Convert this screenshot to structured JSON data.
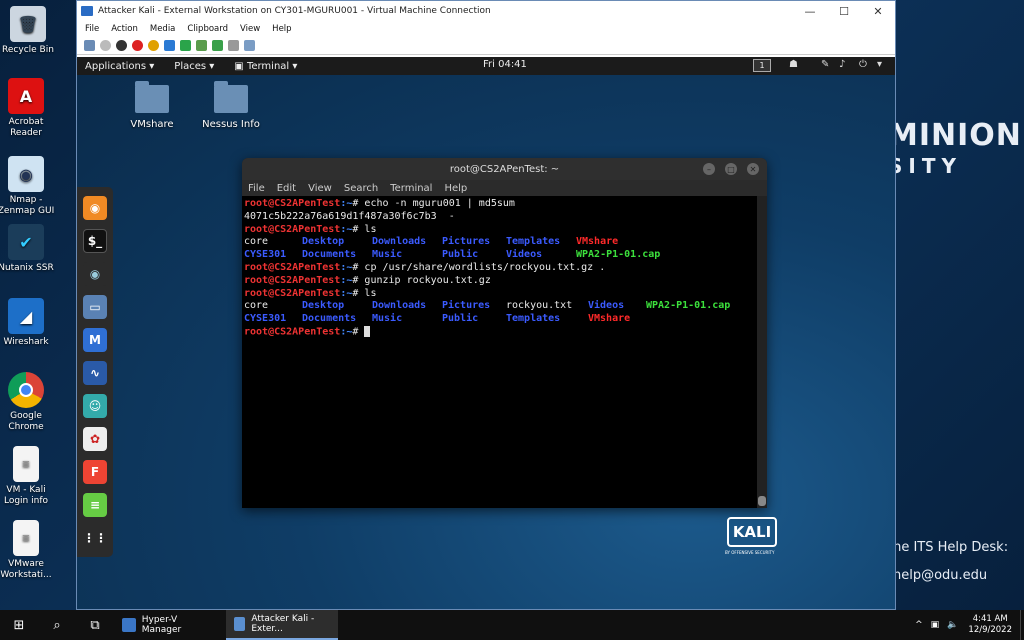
{
  "windows_desktop": {
    "icons": [
      {
        "label": "Recycle Bin"
      },
      {
        "label": "Acrobat Reader"
      },
      {
        "label": "Nmap - Zenmap GUI"
      },
      {
        "label": "Nutanix SSR"
      },
      {
        "label": "Wireshark"
      },
      {
        "label": "Google Chrome"
      },
      {
        "label": "VM - Kali Login info"
      },
      {
        "label": "VMware Workstati..."
      }
    ],
    "bg_text_1": "MINION",
    "bg_text_2": "SITY",
    "help_1": "the ITS Help Desk:",
    "help_2": "help@odu.edu"
  },
  "vm_window": {
    "title": "Attacker Kali - External Workstation on CY301-MGURU001 - Virtual Machine Connection",
    "menu": [
      "File",
      "Action",
      "Media",
      "Clipboard",
      "View",
      "Help"
    ],
    "controls": {
      "minimize": "—",
      "maximize": "☐",
      "close": "✕"
    }
  },
  "kali": {
    "topbar": {
      "applications": "Applications ▾",
      "places": "Places ▾",
      "terminal": "Terminal ▾",
      "clock": "Fri 04:41",
      "workspace": "1"
    },
    "desktop_icons": [
      {
        "label": "VMshare"
      },
      {
        "label": "Nessus Info"
      }
    ],
    "logo": "KALI",
    "logo_sub": "BY OFFENSIVE SECURITY"
  },
  "terminal": {
    "title": "root@CS2APenTest: ~",
    "menu": [
      "File",
      "Edit",
      "View",
      "Search",
      "Terminal",
      "Help"
    ],
    "prompt_user": "root@CS2APenTest",
    "prompt_path": ":~",
    "prompt_end": "# ",
    "cmd1": "echo -n mguru001 | md5sum",
    "out1": "4071c5b222a76a619d1f487a30f6c7b3  -",
    "cmd2": "ls",
    "ls1_row1": {
      "core": "core",
      "desktop": "Desktop",
      "downloads": "Downloads",
      "pictures": "Pictures",
      "templates": "Templates",
      "vmshare": "VMshare"
    },
    "ls1_row2": {
      "cyse": "CYSE301",
      "documents": "Documents",
      "music": "Music",
      "public": "Public",
      "videos": "Videos",
      "cap": "WPA2-P1-01.cap"
    },
    "cmd3": "cp /usr/share/wordlists/rockyou.txt.gz .",
    "cmd4": "gunzip rockyou.txt.gz",
    "cmd5": "ls",
    "ls2_row1": {
      "core": "core",
      "desktop": "Desktop",
      "downloads": "Downloads",
      "pictures": "Pictures",
      "rockyou": "rockyou.txt",
      "videos": "Videos",
      "cap": "WPA2-P1-01.cap"
    },
    "ls2_row2": {
      "cyse": "CYSE301",
      "documents": "Documents",
      "music": "Music",
      "public": "Public",
      "templates": "Templates",
      "vmshare": "VMshare"
    }
  },
  "taskbar": {
    "items": [
      {
        "label": "Hyper-V Manager"
      },
      {
        "label": "Attacker Kali - Exter..."
      }
    ],
    "time": "4:41 AM",
    "date": "12/9/2022"
  }
}
